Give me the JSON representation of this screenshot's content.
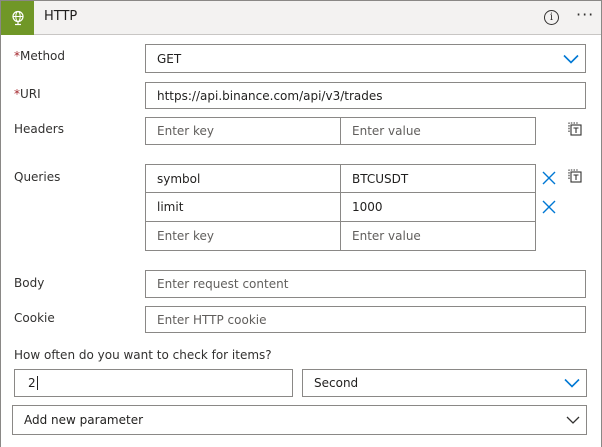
{
  "header": {
    "title": "HTTP"
  },
  "method": {
    "label": "Method",
    "required_marker": "*",
    "value": "GET"
  },
  "uri": {
    "label": "URI",
    "required_marker": "*",
    "value": "https://api.binance.com/api/v3/trades"
  },
  "headers": {
    "label": "Headers",
    "key_placeholder": "Enter key",
    "value_placeholder": "Enter value"
  },
  "queries": {
    "label": "Queries",
    "rows": [
      {
        "key": "symbol",
        "value": "BTCUSDT"
      },
      {
        "key": "limit",
        "value": "1000"
      }
    ],
    "key_placeholder": "Enter key",
    "value_placeholder": "Enter value"
  },
  "body": {
    "label": "Body",
    "placeholder": "Enter request content"
  },
  "cookie": {
    "label": "Cookie",
    "placeholder": "Enter HTTP cookie"
  },
  "recurrence": {
    "question": "How often do you want to check for items?",
    "interval": "2",
    "frequency": "Second"
  },
  "add_parameter": {
    "label": "Add new parameter"
  },
  "colors": {
    "header_icon_bg": "#709727",
    "accent": "#0078d4",
    "required": "#a4262c"
  },
  "icons": [
    "globe-icon",
    "info-icon",
    "more-icon",
    "chevron-down-icon",
    "switch-to-text-icon",
    "delete-icon"
  ]
}
